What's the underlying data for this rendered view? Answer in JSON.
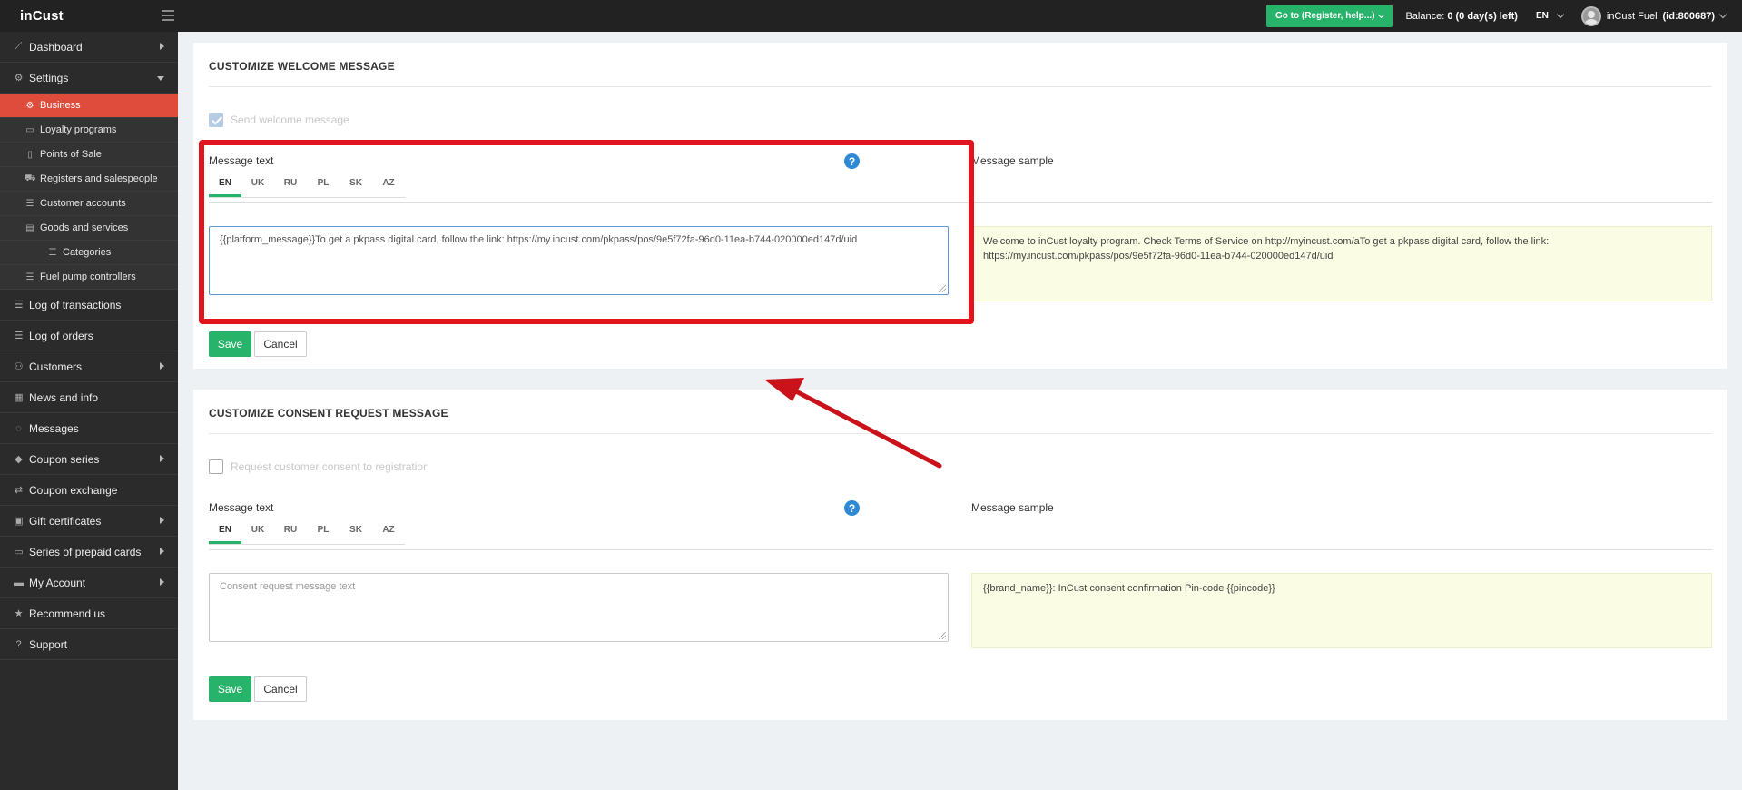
{
  "topbar": {
    "logo": "inCust",
    "goto_button": "Go to (Register, help...)",
    "balance_label": "Balance:",
    "balance_value": "0 (0 day(s) left)",
    "language": "EN",
    "user_name": "inCust Fuel",
    "user_id": "(id:800687)"
  },
  "sidebar": {
    "items": [
      {
        "label": "Dashboard",
        "icon": "chart-line-icon"
      },
      {
        "label": "Settings",
        "icon": "gear-icon"
      },
      {
        "label": "Business",
        "icon": "gear-icon"
      },
      {
        "label": "Loyalty programs",
        "icon": "briefcase-icon"
      },
      {
        "label": "Points of Sale",
        "icon": "building-icon"
      },
      {
        "label": "Registers and salespeople",
        "icon": "cart-icon"
      },
      {
        "label": "Customer accounts",
        "icon": "list-icon"
      },
      {
        "label": "Goods and services",
        "icon": "box-icon"
      },
      {
        "label": "Categories",
        "icon": "list-icon"
      },
      {
        "label": "Fuel pump controllers",
        "icon": "list-icon"
      },
      {
        "label": "Log of transactions",
        "icon": "list-icon"
      },
      {
        "label": "Log of orders",
        "icon": "list-icon"
      },
      {
        "label": "Customers",
        "icon": "users-icon"
      },
      {
        "label": "News and info",
        "icon": "newspaper-icon"
      },
      {
        "label": "Messages",
        "icon": "comment-icon"
      },
      {
        "label": "Coupon series",
        "icon": "tag-icon"
      },
      {
        "label": "Coupon exchange",
        "icon": "exchange-icon"
      },
      {
        "label": "Gift certificates",
        "icon": "gift-icon"
      },
      {
        "label": "Series of prepaid cards",
        "icon": "card-icon"
      },
      {
        "label": "My Account",
        "icon": "account-icon"
      },
      {
        "label": "Recommend us",
        "icon": "star-icon"
      },
      {
        "label": "Support",
        "icon": "question-icon"
      }
    ]
  },
  "welcome": {
    "title": "CUSTOMIZE WELCOME MESSAGE",
    "checkbox_label": "Send welcome message",
    "checkbox_checked": true,
    "message_text_label": "Message text",
    "tabs": [
      "EN",
      "UK",
      "RU",
      "PL",
      "SK",
      "AZ"
    ],
    "active_tab": "EN",
    "message_value": "{{platform_message}}To get a pkpass digital card, follow the link: https://my.incust.com/pkpass/pos/9e5f72fa-96d0-11ea-b744-020000ed147d/uid",
    "sample_label": "Message sample",
    "sample_text": "Welcome to inCust loyalty program. Check Terms of Service on http://myincust.com/aTo get a pkpass digital card, follow the link: https://my.incust.com/pkpass/pos/9e5f72fa-96d0-11ea-b744-020000ed147d/uid",
    "save_label": "Save",
    "cancel_label": "Cancel"
  },
  "consent": {
    "title": "CUSTOMIZE CONSENT REQUEST MESSAGE",
    "checkbox_label": "Request customer consent to registration",
    "checkbox_checked": false,
    "message_text_label": "Message text",
    "tabs": [
      "EN",
      "UK",
      "RU",
      "PL",
      "SK",
      "AZ"
    ],
    "active_tab": "EN",
    "placeholder": "Consent request message text",
    "sample_label": "Message sample",
    "sample_text": "{{brand_name}}: InCust consent confirmation Pin-code {{pincode}}",
    "save_label": "Save",
    "cancel_label": "Cancel"
  },
  "colors": {
    "accent_green": "#27b36a",
    "active_red": "#e04c3b",
    "annotation_red": "#e3141c",
    "sidebar_bg": "#2b2b2b"
  }
}
